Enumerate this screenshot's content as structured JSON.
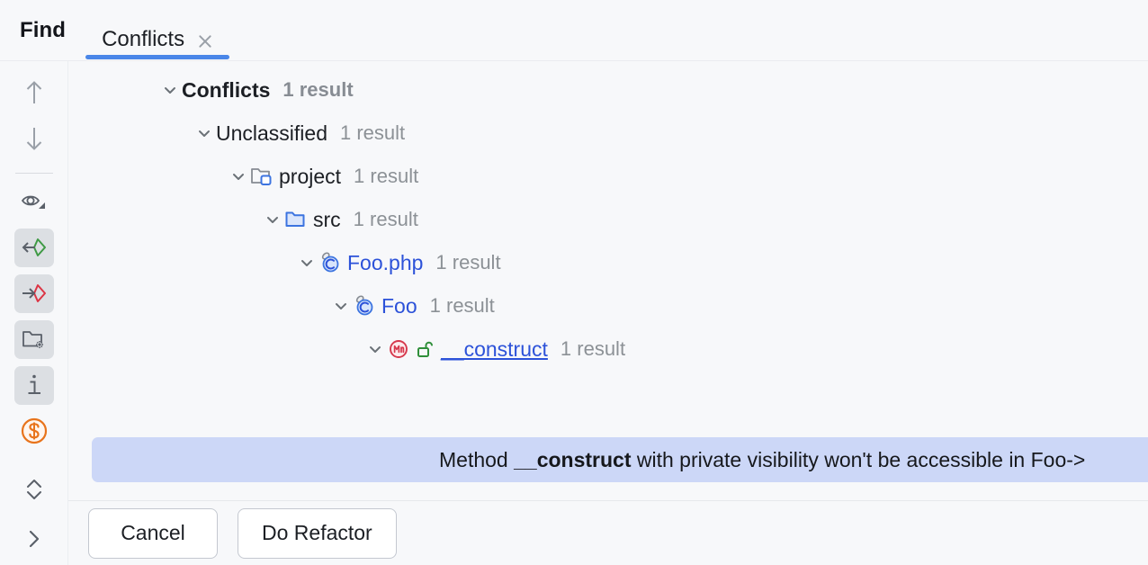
{
  "header": {
    "title": "Find",
    "tab": {
      "label": "Conflicts",
      "close_icon": "close-icon",
      "active": true,
      "accent_color": "#4a86e8"
    }
  },
  "toolbar": {
    "items": [
      {
        "name": "previous-occurrence-button",
        "icon": "arrow-up-icon",
        "selected": false
      },
      {
        "name": "next-occurrence-button",
        "icon": "arrow-down-icon",
        "selected": false
      },
      {
        "name": "preview-usages-button",
        "icon": "eye-dropdown-icon",
        "selected": false
      },
      {
        "name": "show-read-access-button",
        "icon": "arrow-left-into-shape-green-icon",
        "selected": true
      },
      {
        "name": "show-write-access-button",
        "icon": "arrow-right-into-shape-red-icon",
        "selected": true
      },
      {
        "name": "group-by-folder-button",
        "icon": "folder-sparkle-icon",
        "selected": true
      },
      {
        "name": "show-details-button",
        "icon": "info-icon",
        "selected": true
      },
      {
        "name": "dollar-marker-button",
        "icon": "dollar-circle-icon",
        "selected": false
      },
      {
        "name": "expand-collapse-all-button",
        "icon": "chevron-up-down-icon",
        "selected": false
      },
      {
        "name": "open-side-panel-button",
        "icon": "chevron-right-icon",
        "selected": false
      }
    ]
  },
  "tree": {
    "result_label": "1 result",
    "nodes": [
      {
        "name": "tree-node-conflicts",
        "label": "Conflicts",
        "count": "1 result",
        "bold": true,
        "link": false,
        "underline": false,
        "icon": "none",
        "indent": 0,
        "expanded": true
      },
      {
        "name": "tree-node-unclassified",
        "label": "Unclassified",
        "count": "1 result",
        "bold": false,
        "link": false,
        "underline": false,
        "icon": "none",
        "indent": 1,
        "expanded": true
      },
      {
        "name": "tree-node-project",
        "label": "project",
        "count": "1 result",
        "bold": false,
        "link": false,
        "underline": false,
        "icon": "module-icon",
        "indent": 2,
        "expanded": true
      },
      {
        "name": "tree-node-src",
        "label": "src",
        "count": "1 result",
        "bold": false,
        "link": false,
        "underline": false,
        "icon": "folder-icon",
        "indent": 3,
        "expanded": true
      },
      {
        "name": "tree-node-foo-php",
        "label": "Foo.php",
        "count": "1 result",
        "bold": false,
        "link": true,
        "underline": false,
        "icon": "php-class-icon",
        "indent": 4,
        "expanded": true
      },
      {
        "name": "tree-node-foo-class",
        "label": "Foo",
        "count": "1 result",
        "bold": false,
        "link": true,
        "underline": false,
        "icon": "php-class-icon",
        "indent": 5,
        "expanded": true
      },
      {
        "name": "tree-node-construct",
        "label": "__construct",
        "count": "1 result",
        "bold": false,
        "link": true,
        "underline": true,
        "icon": "method-public-icon",
        "indent": 6,
        "expanded": true
      }
    ],
    "message": {
      "prefix": "Method ",
      "emphasis": "__construct",
      "suffix": " with private visibility won't be accessible in Foo->",
      "highlight_color": "#ccd7f7"
    }
  },
  "footer": {
    "cancel_label": "Cancel",
    "do_refactor_label": "Do Refactor"
  }
}
